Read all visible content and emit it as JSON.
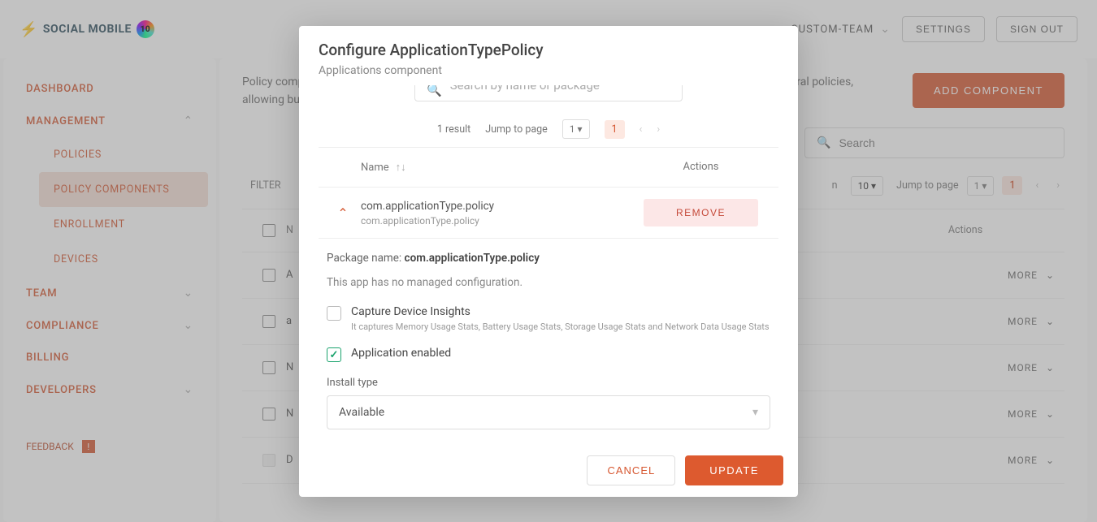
{
  "header": {
    "brand": "SOCIAL MOBILE",
    "ten": "10",
    "team": "CUSTOM-TEAM",
    "settings": "SETTINGS",
    "signout": "SIGN OUT"
  },
  "sidebar": {
    "dashboard": "DASHBOARD",
    "management": "MANAGEMENT",
    "policies": "POLICIES",
    "policy_components": "POLICY COMPONENTS",
    "enrollment": "ENROLLMENT",
    "devices": "DEVICES",
    "team": "TEAM",
    "compliance": "COMPLIANCE",
    "billing": "BILLING",
    "developers": "DEVELOPERS",
    "feedback": "FEEDBACK",
    "feedback_badge": "!"
  },
  "main": {
    "desc": "Policy components allow to share common policy properties such as applications, Wi-Fi networks across several policies, allowing bu",
    "add_component": "ADD COMPONENT",
    "search_placeholder": "Search",
    "filter_label": "FILTER",
    "pagination": {
      "results_on": "n",
      "rows_value": "10",
      "jump_label": "Jump to page",
      "jump_value": "1",
      "current_page": "1"
    },
    "thead": {
      "name": "N",
      "actions": "Actions"
    },
    "rows": [
      {
        "name": "A",
        "more": "MORE"
      },
      {
        "name": "a",
        "more": "MORE"
      },
      {
        "name": "N",
        "more": "MORE"
      },
      {
        "name": "N",
        "more": "MORE"
      },
      {
        "name": "D",
        "more": "MORE",
        "disabled": true
      }
    ]
  },
  "modal": {
    "title": "Configure ApplicationTypePolicy",
    "subtitle": "Applications component",
    "search_placeholder": "Search by name or package",
    "results": "1 result",
    "jump_label": "Jump to page",
    "jump_value": "1",
    "current_page": "1",
    "thead": {
      "name": "Name",
      "actions": "Actions"
    },
    "row": {
      "title": "com.applicationType.policy",
      "subtitle": "com.applicationType.policy",
      "remove": "REMOVE"
    },
    "panel": {
      "pk_label": "Package name: ",
      "pk_value": "com.applicationType.policy",
      "no_config": "This app has no managed configuration.",
      "capture_label": "Capture Device Insights",
      "capture_help": "It captures Memory Usage Stats, Battery Usage Stats, Storage Usage Stats and Network Data Usage Stats",
      "enabled_label": "Application enabled",
      "install_label": "Install type",
      "install_value": "Available"
    },
    "cancel": "CANCEL",
    "update": "UPDATE"
  }
}
